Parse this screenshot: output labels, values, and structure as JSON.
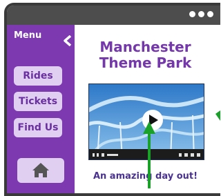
{
  "sidebar": {
    "menu_label": "Menu",
    "items": [
      {
        "label": "Rides"
      },
      {
        "label": "Tickets"
      },
      {
        "label": "Find Us"
      }
    ]
  },
  "main": {
    "title_line1": "Manchester",
    "title_line2": "Theme Park",
    "tagline": "An amazing day out!"
  },
  "colors": {
    "sidebar": "#7d39b0",
    "nav_button": "#e0cff0",
    "title": "#7438ab",
    "arrow": "#1aa12a"
  },
  "icons": [
    "chevron-left-icon",
    "home-icon",
    "play-icon",
    "window-dots-icon"
  ]
}
